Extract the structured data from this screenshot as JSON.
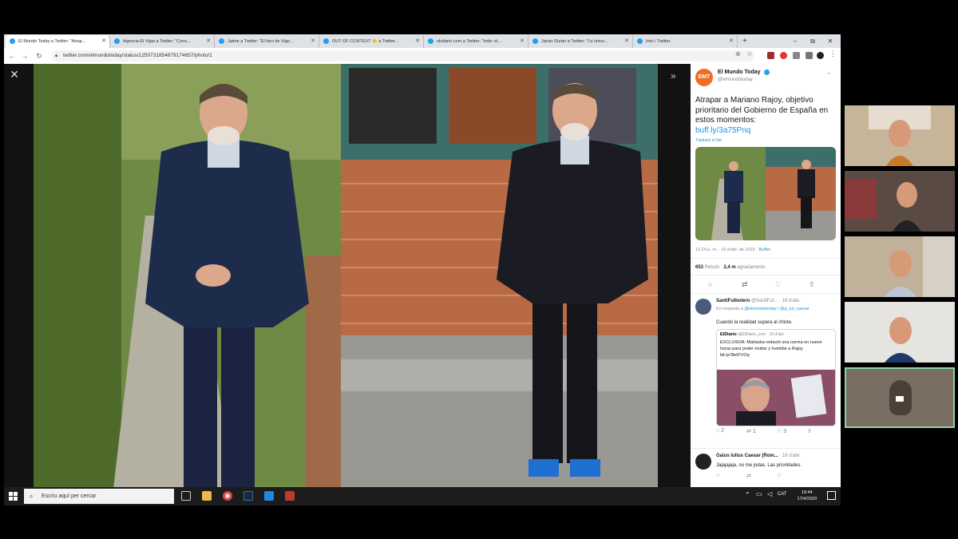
{
  "tabs": [
    {
      "label": "El Mundo Today a Twitter: \"Atrap...",
      "active": true
    },
    {
      "label": "Agencia El Vigia a Twitter: \"Cons...",
      "active": false
    },
    {
      "label": "Jaime a Twitter: \"El faro de Vigo...",
      "active": false
    },
    {
      "label": "OUT OF CONTEXT 👏 a Twitter...",
      "active": false
    },
    {
      "label": "okdiario.com a Twitter: \"Indo: el...",
      "active": false
    },
    {
      "label": "Javier Durán a Twitter: \"Lo único...",
      "active": false
    },
    {
      "label": "Inici / Twitter",
      "active": false
    }
  ],
  "window": {
    "new_tab": "+",
    "minimize": "–",
    "maximize": "⧉",
    "close": "✕"
  },
  "address": {
    "url": "twitter.com/elmundotoday/status/1250731854879174657/photo/1"
  },
  "viewer": {
    "close_icon": "✕",
    "expand_icon": "»"
  },
  "tweet": {
    "avatar_text": "EMT",
    "author": "El Mundo Today",
    "handle": "@elmundotoday",
    "text": "Atrapar a Mariano Rajoy, objetivo prioritario del Gobierno de España en estos momentos:",
    "link": "buff.ly/3a75Pnq",
    "translate": "Tradueix el tuit",
    "meta": "12:24 p. m. · 16 d'abr. de 2020 ·",
    "meta_source": "Buffer",
    "retweets": "653",
    "retweets_label": "Retuits",
    "likes": "2,4 m",
    "likes_label": "agradaments"
  },
  "replies": [
    {
      "author": "SantiFutbolero",
      "handle": "@SantiFut...",
      "date": "· 16 d'abr.",
      "reply_to_label": "En resposta a",
      "reply_to": "@elmundotoday i @g_iul_caesar",
      "text": "Cuando la realidad supera al chiste.",
      "quote": {
        "author": "ElDiario",
        "handle": "@ElDiario_com · 15 d'abr.",
        "text": "EXCLUSIVA: Marlaska redactó una norma en nueve horas para poder multar y humillar a Rajoy bit.ly/3bdYVOq"
      },
      "counts": {
        "replies": "2",
        "retweets": "1",
        "likes": "3"
      }
    },
    {
      "author": "Gaius Iulius Caesar (Rom...",
      "handle": "",
      "date": "· 16 d'abr.",
      "text": "Jajajajaja, no me jodas. Las prioridades."
    }
  ],
  "taskbar": {
    "search_placeholder": "Escriu aquí per cercar",
    "lang": "CAT",
    "time": "19:44",
    "date": "17/4/2020"
  },
  "colors": {
    "twitter_blue": "#1da1f2",
    "emt_orange": "#f26b21",
    "active_tile_border": "#8fd3a5"
  }
}
